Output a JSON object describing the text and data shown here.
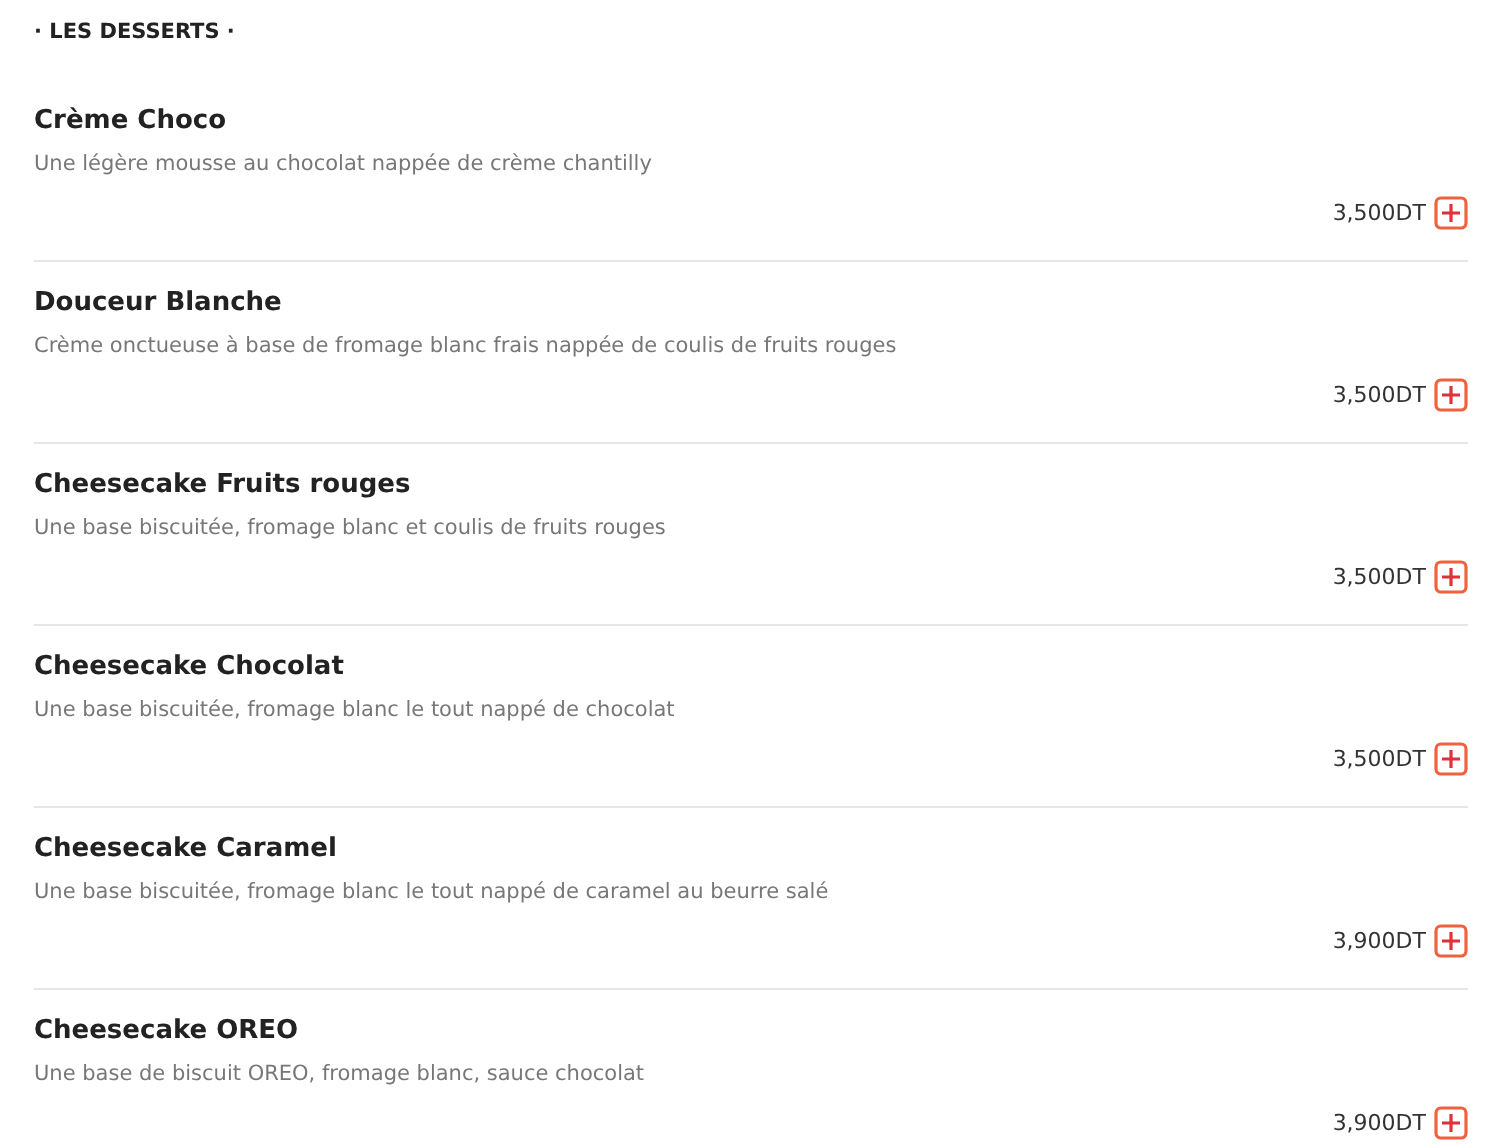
{
  "section_title": "· LES DESSERTS ·",
  "items": [
    {
      "name": "Crème Choco",
      "description": "Une légère mousse au chocolat nappée de crème chantilly",
      "price": "3,500DT"
    },
    {
      "name": "Douceur Blanche",
      "description": "Crème onctueuse à base de fromage blanc frais nappée de coulis de fruits rouges",
      "price": "3,500DT"
    },
    {
      "name": "Cheesecake Fruits rouges",
      "description": "Une base biscuitée, fromage blanc et coulis de fruits rouges",
      "price": "3,500DT"
    },
    {
      "name": "Cheesecake Chocolat",
      "description": "Une base biscuitée, fromage blanc le tout nappé de chocolat",
      "price": "3,500DT"
    },
    {
      "name": "Cheesecake Caramel",
      "description": "Une base biscuitée, fromage blanc le tout nappé de caramel au beurre salé",
      "price": "3,900DT"
    },
    {
      "name": "Cheesecake OREO",
      "description": "Une base de biscuit OREO, fromage blanc, sauce chocolat",
      "price": "3,900DT"
    }
  ]
}
